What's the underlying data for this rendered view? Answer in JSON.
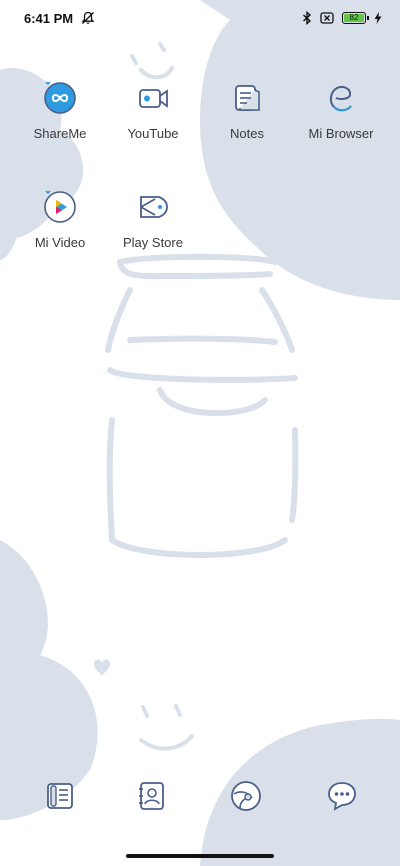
{
  "status_bar": {
    "time": "6:41 PM",
    "left_icon": "notifications-off-icon",
    "right_icons": [
      "bluetooth-icon",
      "sim-off-icon",
      "battery-icon",
      "charging-icon"
    ],
    "battery_level": "82"
  },
  "apps": [
    {
      "label": "ShareMe",
      "icon": "shareme-icon"
    },
    {
      "label": "YouTube",
      "icon": "youtube-icon"
    },
    {
      "label": "Notes",
      "icon": "notes-icon"
    },
    {
      "label": "Mi Browser",
      "icon": "browser-icon"
    },
    {
      "label": "Mi Video",
      "icon": "video-icon"
    },
    {
      "label": "Play Store",
      "icon": "play-store-icon"
    }
  ],
  "dock": [
    {
      "icon": "phone-icon"
    },
    {
      "icon": "contacts-icon"
    },
    {
      "icon": "camera-icon"
    },
    {
      "icon": "messages-icon"
    }
  ],
  "colors": {
    "accent_blue": "#2e9be0",
    "outline": "#4a5f8a",
    "wallpaper_shape": "#d9e0ea",
    "battery_green": "#63c64b"
  }
}
